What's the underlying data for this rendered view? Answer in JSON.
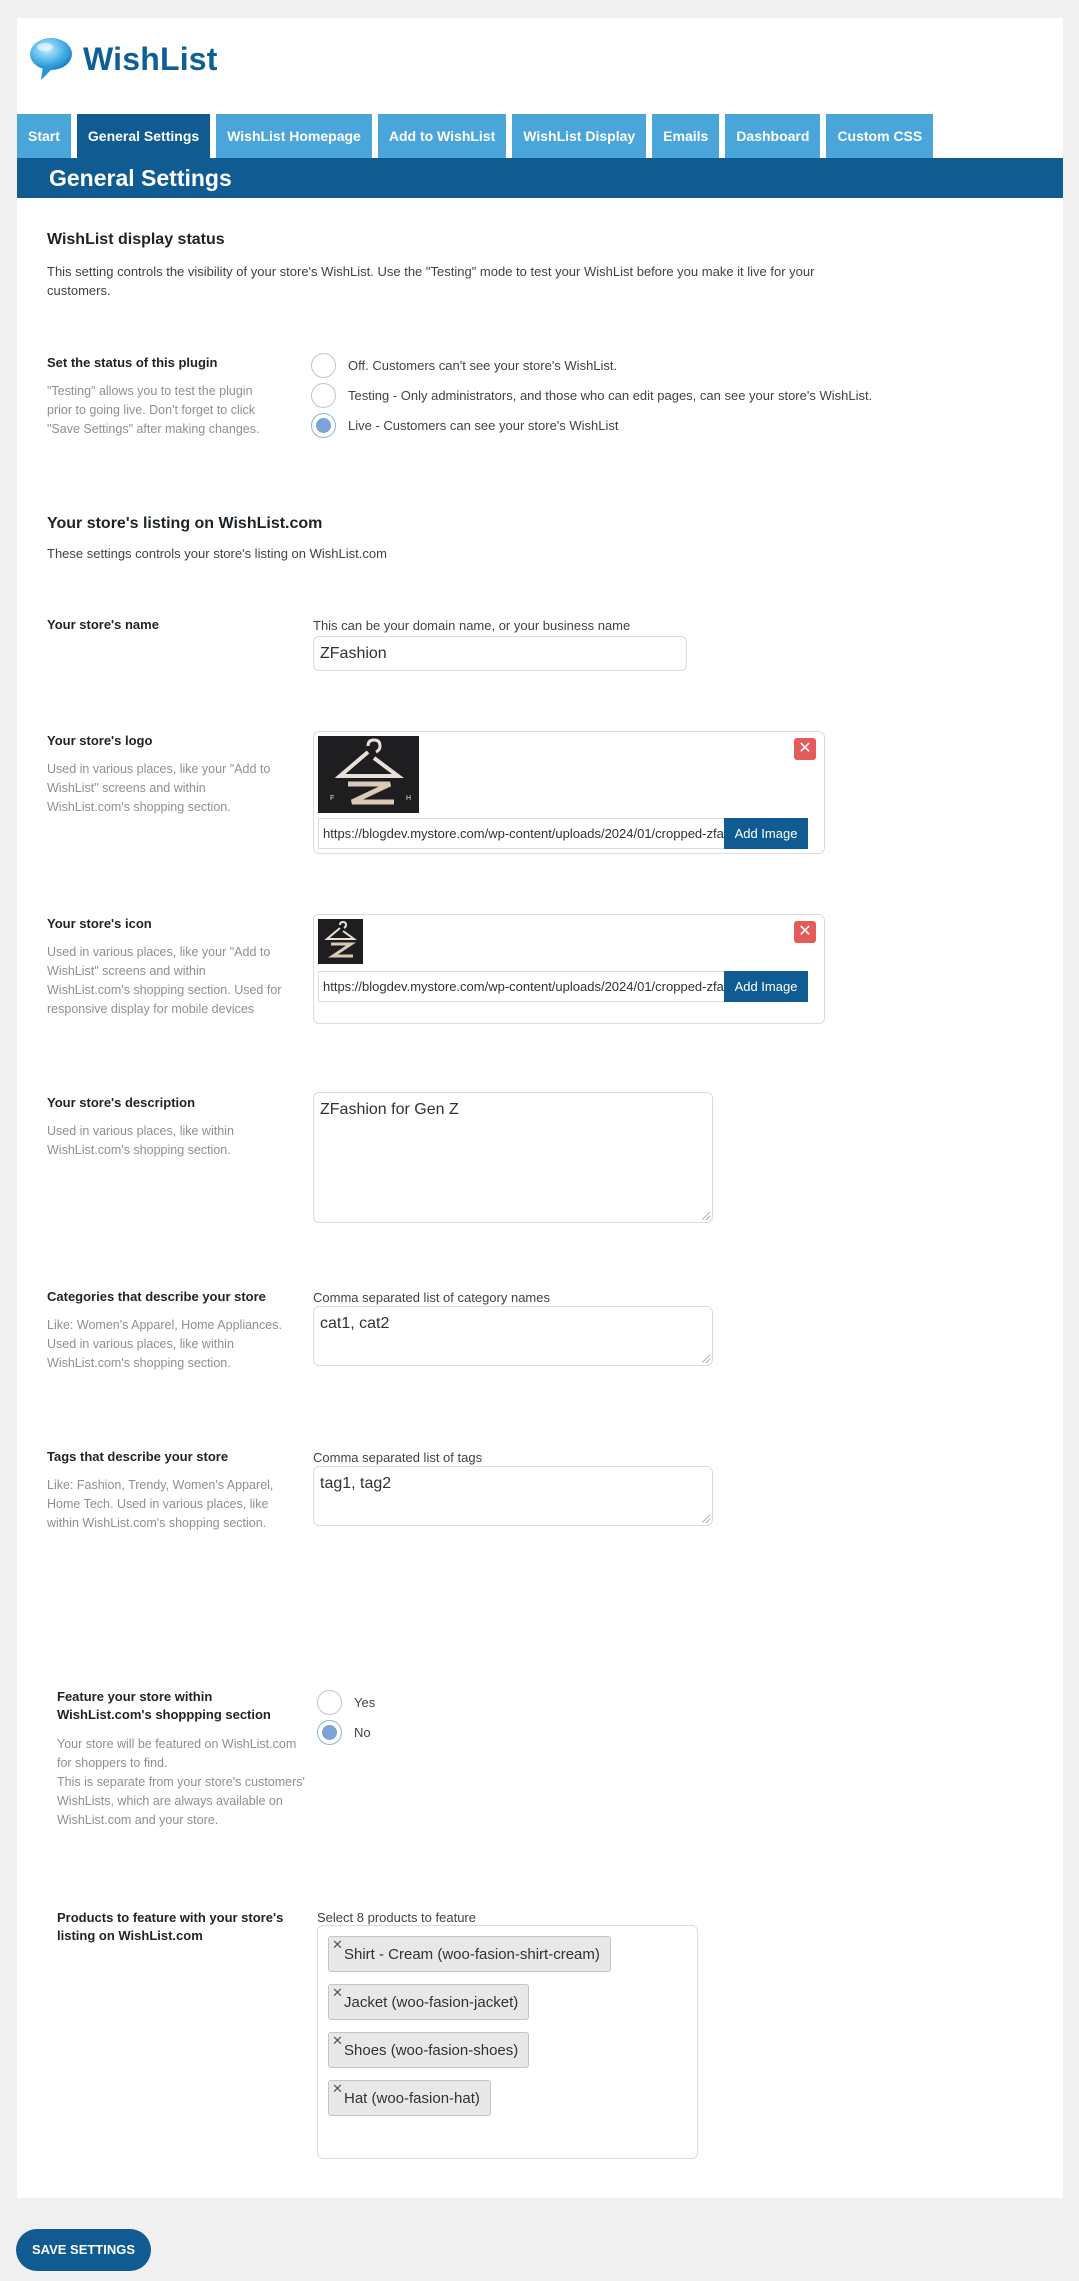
{
  "app": {
    "title": "WishList"
  },
  "tabs": [
    {
      "label": "Start"
    },
    {
      "label": "General Settings"
    },
    {
      "label": "WishList Homepage"
    },
    {
      "label": "Add to WishList"
    },
    {
      "label": "WishList Display"
    },
    {
      "label": "Emails"
    },
    {
      "label": "Dashboard"
    },
    {
      "label": "Custom CSS"
    }
  ],
  "page_title": "General Settings",
  "display_status": {
    "heading": "WishList display status",
    "description": "This setting controls the visibility of your store's WishList. Use the \"Testing\" mode to test your WishList before you make it live for your customers.",
    "label": "Set the status of this plugin",
    "help": "\"Testing\" allows you to test the plugin prior to going live. Don't forget to click \"Save Settings\" after making changes.",
    "options": [
      {
        "label": "Off. Customers can't see your store's WishList.",
        "checked": false
      },
      {
        "label": "Testing - Only administrators, and those who can edit pages, can see your store's WishList.",
        "checked": false
      },
      {
        "label": "Live - Customers can see your store's WishList",
        "checked": true
      }
    ]
  },
  "listing": {
    "heading": "Your store's listing on WishList.com",
    "description": "These settings controls your store's listing on WishList.com"
  },
  "store_name": {
    "label": "Your store's name",
    "hint": "This can be your domain name, or your business name",
    "value": "ZFashion"
  },
  "store_logo": {
    "label": "Your store's logo",
    "help": "Used in various places, like your \"Add to WishList\" screens and within WishList.com's shopping section.",
    "url": "https://blogdev.mystore.com/wp-content/uploads/2024/01/cropped-zfashion-logo.png",
    "button": "Add Image",
    "remove_icon": "close-icon"
  },
  "store_icon": {
    "label": "Your store's icon",
    "help": "Used in various places, like your \"Add to WishList\" screens and within WishList.com's shopping section. Used for responsive display for mobile devices",
    "url": "https://blogdev.mystore.com/wp-content/uploads/2024/01/cropped-zfashion-icon.png",
    "button": "Add Image"
  },
  "store_description": {
    "label": "Your store's description",
    "help": "Used in various places, like within WishList.com's shopping section.",
    "value": "ZFashion for Gen Z"
  },
  "categories": {
    "label": "Categories that describe your store",
    "help": "Like: Women's Apparel, Home Appliances. Used in various places, like within WishList.com's shopping section.",
    "hint": "Comma separated list of category names",
    "value": "cat1, cat2"
  },
  "tags": {
    "label": "Tags that describe your store",
    "help": "Like: Fashion, Trendy, Women's Apparel, Home Tech. Used in various places, like within WishList.com's shopping section.",
    "hint": "Comma separated list of tags",
    "value": "tag1, tag2"
  },
  "feature": {
    "label": "Feature your store within WishList.com's shoppping section",
    "help1": "Your store will be featured on WishList.com for shoppers to find.",
    "help2": "This is separate from your store's customers' WishLists, which are always available on WishList.com and your store.",
    "options": [
      {
        "label": "Yes",
        "checked": false
      },
      {
        "label": "No",
        "checked": true
      }
    ]
  },
  "products": {
    "label": "Products to feature with your store's listing on WishList.com",
    "hint": "Select 8 products to feature",
    "items": [
      {
        "label": "Shirt - Cream (woo-fasion-shirt-cream)"
      },
      {
        "label": "Jacket (woo-fasion-jacket)"
      },
      {
        "label": "Shoes (woo-fasion-shoes)"
      },
      {
        "label": "Hat (woo-fasion-hat)"
      }
    ]
  },
  "save_label": "SAVE SETTINGS",
  "colors": {
    "brand": "#0f5b92",
    "tab": "#4aa6da",
    "danger": "#e35b5b"
  }
}
